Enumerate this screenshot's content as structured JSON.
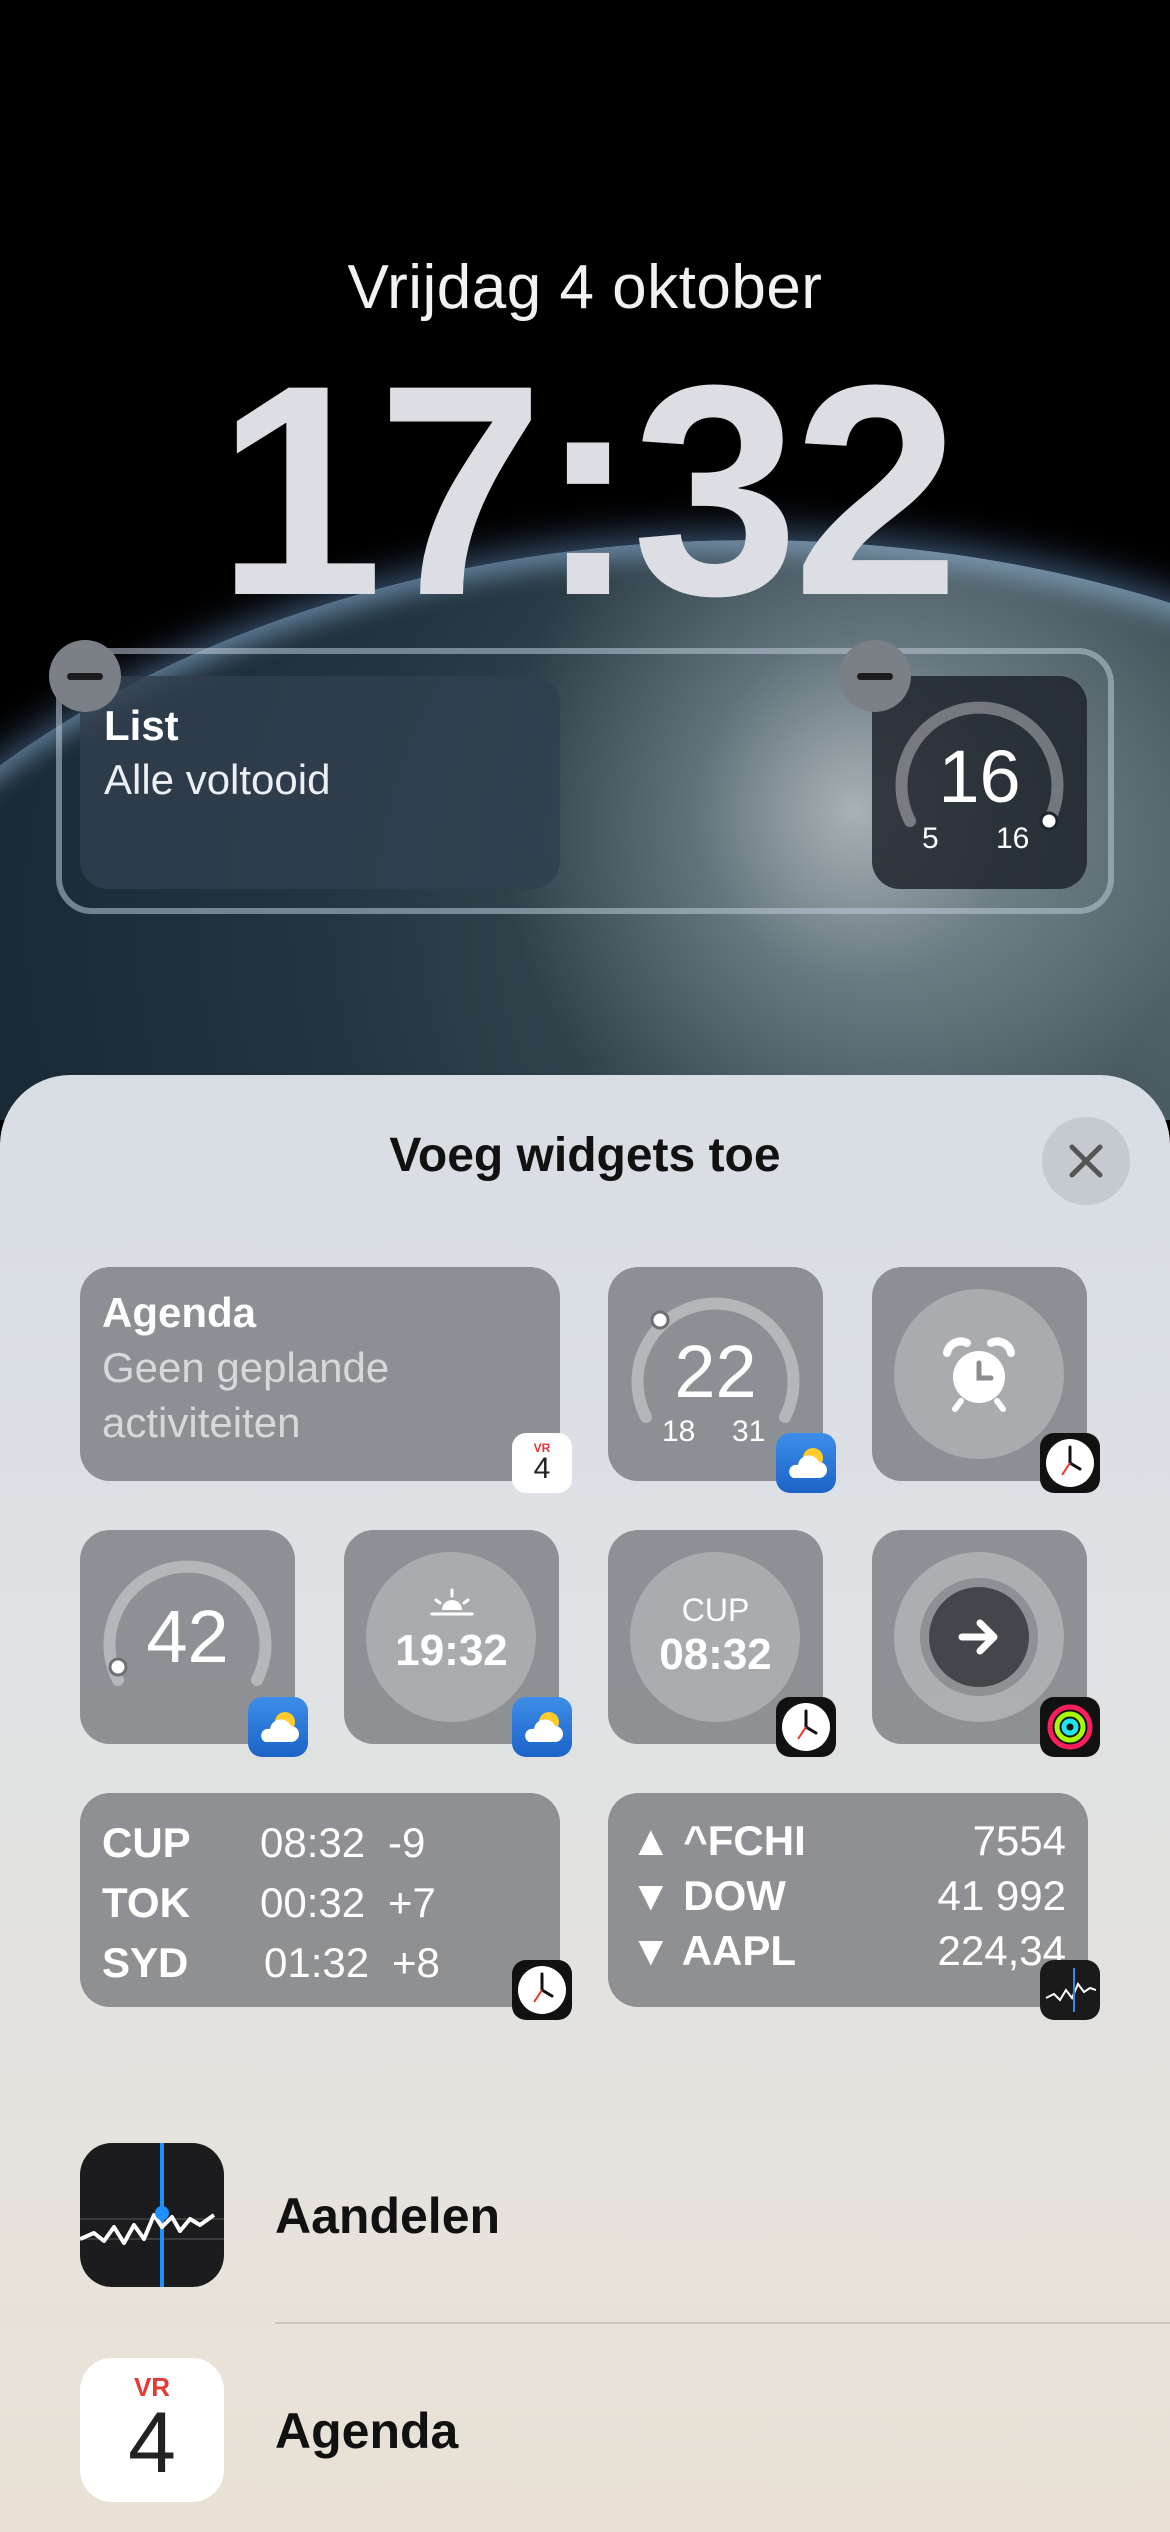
{
  "lockscreen": {
    "date": "Vrijdag 4 oktober",
    "time": "17:32",
    "widgets": {
      "list": {
        "title": "List",
        "subtitle": "Alle voltooid"
      },
      "gauge": {
        "value": "16",
        "min": "5",
        "max": "16",
        "level": 1.0
      }
    }
  },
  "sheet": {
    "title": "Voeg widgets toe",
    "close_icon": "close-icon",
    "tiles": {
      "agenda": {
        "title": "Agenda",
        "subtitle_line1": "Geen geplande",
        "subtitle_line2": "activiteiten",
        "badge_month": "VR",
        "badge_day": "4"
      },
      "temp_range": {
        "value": "22",
        "low": "18",
        "high": "31",
        "level": 0.05
      },
      "alarm": {
        "icon": "alarm-clock-icon"
      },
      "aqi": {
        "value": "42",
        "level": 0.0
      },
      "sunset": {
        "time": "19:32",
        "icon": "sunset-icon"
      },
      "city_clock": {
        "city": "CUP",
        "time": "08:32"
      },
      "fitness": {
        "icon": "arrow-right-icon"
      },
      "world_clock": {
        "rows": [
          {
            "city": "CUP",
            "time": "08:32",
            "offset": "-9"
          },
          {
            "city": "TOK",
            "time": "00:32",
            "offset": "+7"
          },
          {
            "city": "SYD",
            "time": "01:32",
            "offset": "+8"
          }
        ]
      },
      "stocks": {
        "rows": [
          {
            "direction": "up",
            "arrow": "▲",
            "symbol": "^FCHI",
            "value": "7554"
          },
          {
            "direction": "down",
            "arrow": "▼",
            "symbol": "DOW",
            "value": "41 992"
          },
          {
            "direction": "down",
            "arrow": "▼",
            "symbol": "AAPL",
            "value": "224,34"
          }
        ]
      }
    },
    "apps": [
      {
        "name": "Aandelen",
        "icon": "stocks-app-icon"
      },
      {
        "name": "Agenda",
        "icon": "calendar-app-icon",
        "month": "VR",
        "day": "4"
      }
    ]
  }
}
